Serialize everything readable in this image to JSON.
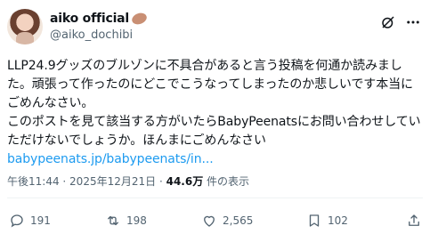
{
  "author": {
    "display_name": "aiko official",
    "handle": "@aiko_dochibi",
    "emoji": "bicep-emoji"
  },
  "tweet": {
    "lines": [
      "LLP24.9グッズのブルゾンに不具合があると言う投稿を何通か読みまし",
      "た。頑張って作ったのにどこでこうなってしまったのか悲しいです本当に",
      "ごめんなさい。",
      "このポストを見て該当する方がいたらBabyPeenatsにお問い合わせしてい",
      "ただけないでしょうか。ほんまにごめんなさい"
    ],
    "link": "babypeenats.jp/babypeenats/in..."
  },
  "meta": {
    "time": "午後11:44",
    "separator": " · ",
    "date": "2025年12月21日",
    "views_count": "44.6万",
    "views_label": " 件の表示"
  },
  "actions": {
    "replies": "191",
    "reposts": "198",
    "likes": "2,565",
    "bookmarks": "102"
  },
  "icons": {
    "header": [
      "grok-icon",
      "more-icon"
    ],
    "actions": [
      "reply-icon",
      "repost-icon",
      "like-icon",
      "bookmark-icon",
      "share-icon"
    ]
  },
  "colors": {
    "text": "#0f1419",
    "secondary": "#536471",
    "link": "#1d9bf0"
  }
}
